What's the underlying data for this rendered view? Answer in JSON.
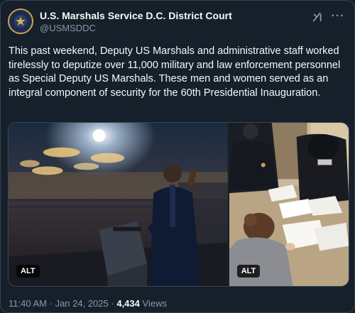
{
  "account": {
    "display_name": "U.S. Marshals Service D.C. District Court",
    "handle": "@USMSDDC",
    "avatar_icon": "usms-star-badge-icon"
  },
  "header_actions": {
    "grok_icon": "grok-icon",
    "more_icon": "more-icon",
    "more_glyph": "···"
  },
  "tweet": {
    "text": "This past weekend, Deputy US Marshals and administrative staff worked tirelessly to deputize over 11,000 military and law enforcement personnel as Special Deputy US Marshals. These men and women served as an integral component of security for the 60th Presidential Inauguration."
  },
  "media": {
    "photos": [
      {
        "alt_label": "ALT",
        "subject": "ballroom-swearing-in-photo"
      },
      {
        "alt_label": "ALT",
        "subject": "paperwork-signing-photo"
      }
    ]
  },
  "meta": {
    "time": "11:40 AM",
    "separator": "·",
    "date": "Jan 24, 2025",
    "views_count": "4,434",
    "views_label": "Views"
  },
  "colors": {
    "background": "#15202b",
    "text_primary": "#f7f9f9",
    "text_secondary": "#8b98a5",
    "border": "#38444d"
  }
}
